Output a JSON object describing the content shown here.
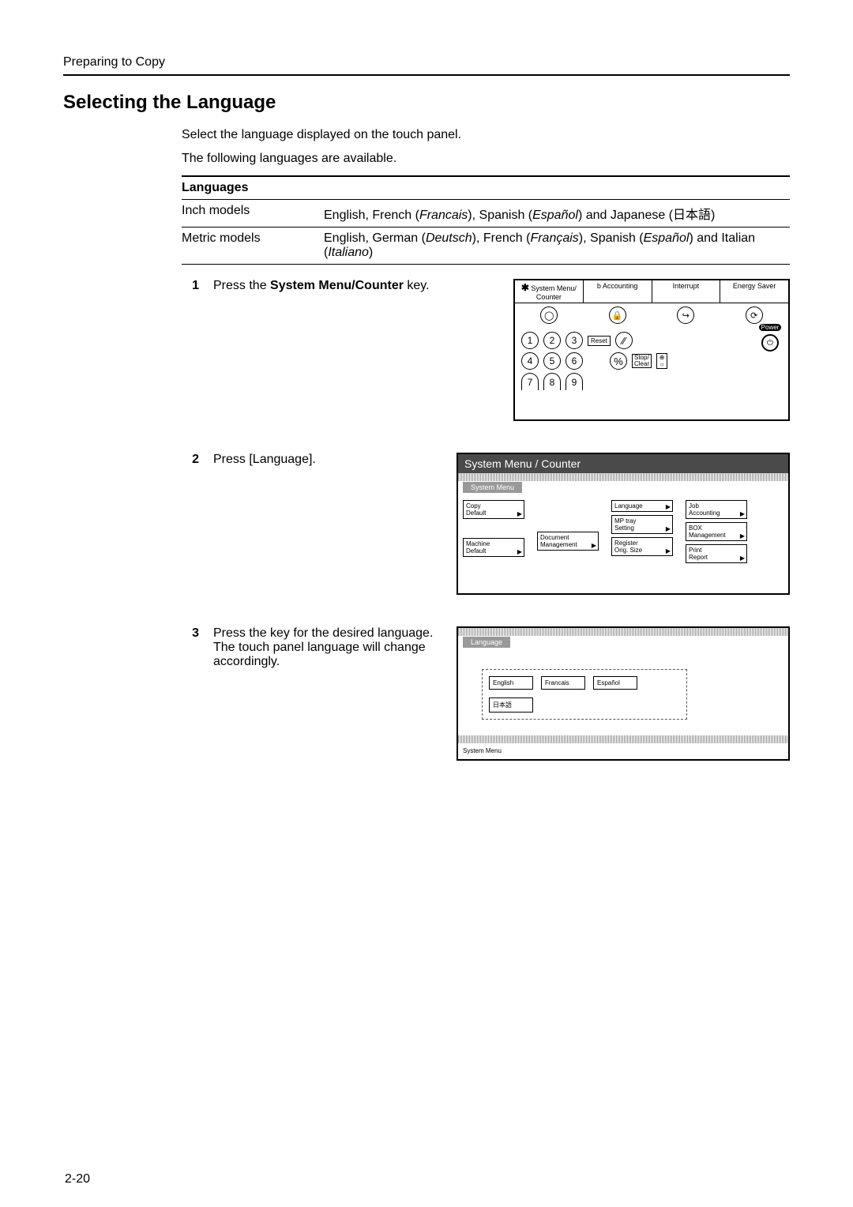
{
  "header": {
    "crumb": "Preparing to Copy"
  },
  "title": "Selecting the Language",
  "intro": {
    "p1": "Select the language displayed on the touch panel.",
    "p2": "The following languages are available."
  },
  "table": {
    "header": "Languages",
    "rows": [
      {
        "model": "Inch models",
        "langs_prefix": "English, French (",
        "langs_i1": "Francais",
        "langs_mid1": "), Spanish (",
        "langs_i2": "Español",
        "langs_mid2": ") and Japanese (",
        "langs_jp": "日本語",
        "langs_suffix": ")"
      },
      {
        "model": "Metric models",
        "langs_prefix": "English, German (",
        "langs_i1": "Deutsch",
        "langs_mid1": "), French (",
        "langs_i2": "Français",
        "langs_mid2": "), Spanish (",
        "langs_i3": "Español",
        "langs_mid3": ") and Italian (",
        "langs_i4": "Italiano",
        "langs_suffix": ")"
      }
    ]
  },
  "steps": {
    "s1": {
      "num": "1",
      "text_pre": "Press the ",
      "text_bold": "System Menu/Counter",
      "text_post": " key."
    },
    "s2": {
      "num": "2",
      "text": "Press [Language]."
    },
    "s3": {
      "num": "3",
      "text": "Press the key for the desired language. The touch panel language will change accordingly."
    }
  },
  "panel1": {
    "labels": {
      "sysmenu": "System Menu/ Counter",
      "jobacc": "b Accounting",
      "interrupt": "Interrupt",
      "energy": "Energy Saver"
    },
    "nums": {
      "n1": "1",
      "n2": "2",
      "n3": "3",
      "n4": "4",
      "n5": "5",
      "n6": "6",
      "n7": "7",
      "n8": "8",
      "n9": "9"
    },
    "reset": "Reset",
    "power": "Power",
    "stopclear": "Stop/\nClear",
    "percent": "%"
  },
  "panel2": {
    "title": "System Menu / Counter",
    "tab": "System Menu",
    "buttons": {
      "copydefault": "Copy\nDefault",
      "machinedefault": "Machine\nDefault",
      "docmgmt": "Document\nManagement",
      "language": "Language",
      "mptray": "MP tray\nSetting",
      "regsize": "Register\nOrig. Size",
      "jobacc": "Job\nAccounting",
      "boxmgmt": "BOX\nManagement",
      "printreport": "Print\nReport"
    }
  },
  "panel3": {
    "tab": "Language",
    "english": "English",
    "francais": "Francais",
    "espanol": "Español",
    "japanese": "日本語",
    "footer": "System Menu"
  },
  "pagenum": "2-20"
}
